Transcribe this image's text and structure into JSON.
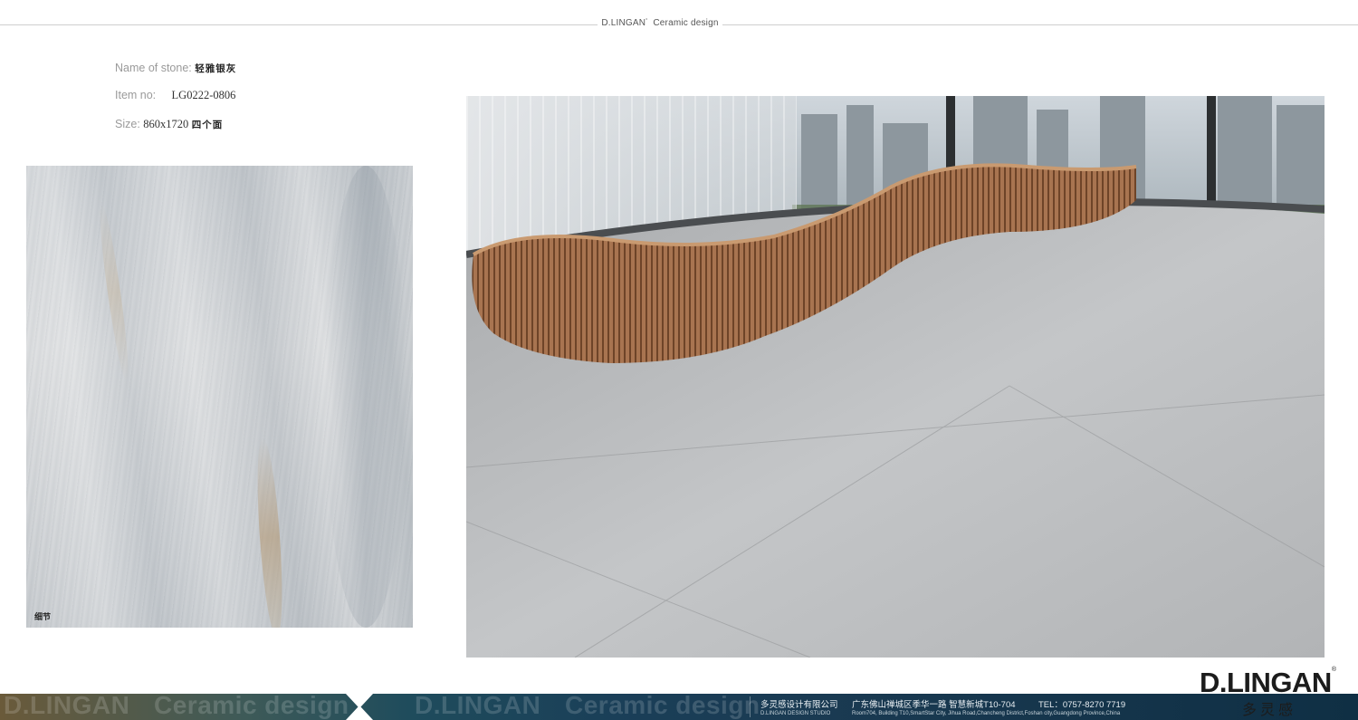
{
  "header": {
    "brand": "D.LINGAN",
    "brand_mark": "°",
    "subtitle": "Ceramic design"
  },
  "specs": {
    "name_label": "Name  of stone:",
    "name_value": "轻雅银灰",
    "item_label": "Item no:",
    "item_value": "LG0222-0806",
    "size_label": "Size:",
    "size_value": "860x1720",
    "size_note": "四个面"
  },
  "sample": {
    "label": "细节"
  },
  "logo": {
    "name": "D.LINGAN",
    "mark": "®",
    "chinese": "多灵感"
  },
  "footer": {
    "ghost_brand": "D.LINGAN",
    "ghost_tagline": "Ceramic design",
    "company": "多灵感设计有限公司",
    "studio": "D.LINGAN DESIGN STUDIO",
    "address": "广东佛山禅城区季华一路  智慧新城T10-704",
    "address_en": "Room704, Building T10,SmartStar City, Jihua Road,Chancheng  District,Foshan  city,Guangdong Province,China",
    "tel": "TEL：0757-8270 7719"
  },
  "colors": {
    "footer_dark": "#1a3f58",
    "footer_warm": "#6a5a3a",
    "bench_wood": "#9a6b45",
    "floor_gray": "#b9bbbd"
  }
}
